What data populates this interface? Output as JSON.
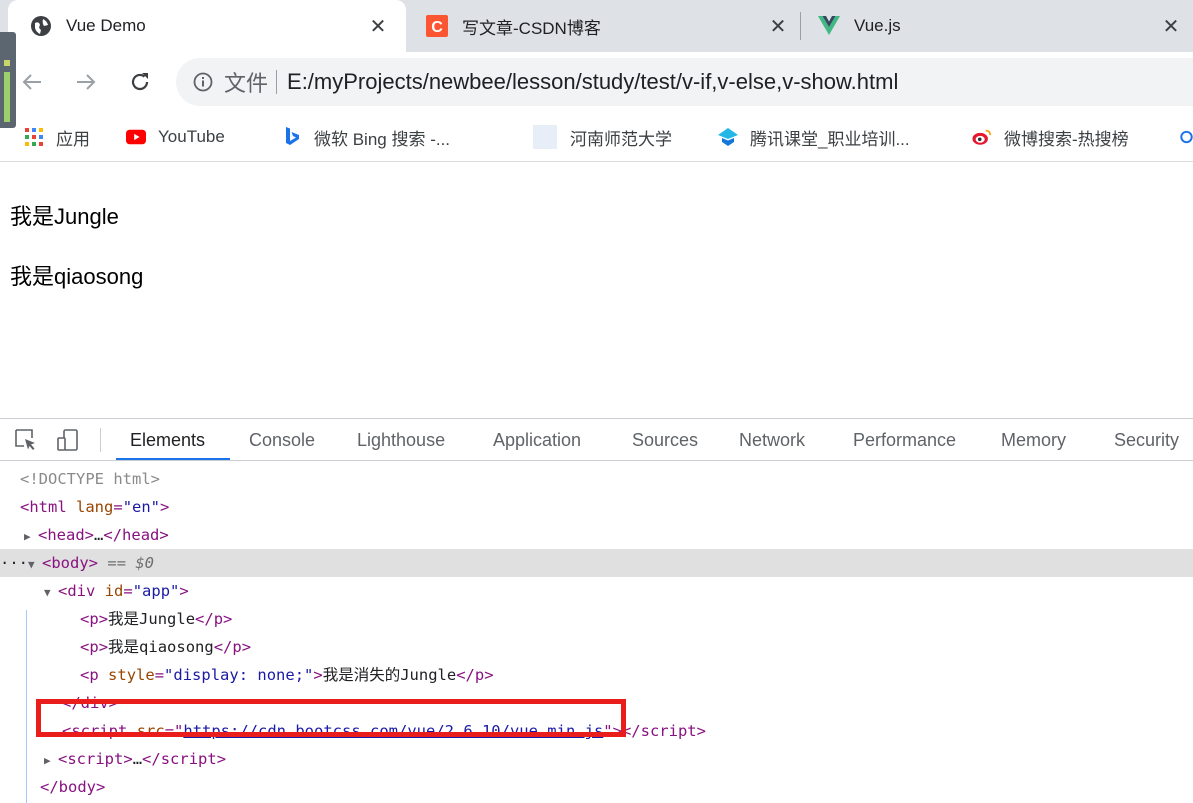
{
  "browser": {
    "tabs": [
      {
        "title": "Vue Demo",
        "icon": "globe-icon",
        "active": true,
        "close": "✕"
      },
      {
        "title": "写文章-CSDN博客",
        "icon": "csdn-icon",
        "active": false,
        "close": "✕"
      },
      {
        "title": "Vue.js",
        "icon": "vue-icon",
        "active": false,
        "close": "✕"
      }
    ],
    "address": {
      "scheme_label": "文件",
      "url": "E:/myProjects/newbee/lesson/study/test/v-if,v-else,v-show.html"
    },
    "bookmarks": [
      {
        "label": "应用",
        "icon": "apps-grid-icon"
      },
      {
        "label": "YouTube",
        "icon": "youtube-icon"
      },
      {
        "label": "微软 Bing 搜索 -...",
        "icon": "bing-icon"
      },
      {
        "label": "河南师范大学",
        "icon": "blank-page-icon"
      },
      {
        "label": "腾讯课堂_职业培训...",
        "icon": "tencent-classroom-icon"
      },
      {
        "label": "微博搜索-热搜榜",
        "icon": "weibo-icon"
      }
    ]
  },
  "page": {
    "paragraphs": [
      "我是Jungle",
      "我是qiaosong"
    ]
  },
  "devtools": {
    "tabs": [
      "Elements",
      "Console",
      "Lighthouse",
      "Application",
      "Sources",
      "Network",
      "Performance",
      "Memory",
      "Security"
    ],
    "active_tab": "Elements",
    "dom": {
      "doctype": "<!DOCTYPE html>",
      "html_tag": "html",
      "html_attr": "lang",
      "html_val": "\"en\"",
      "head_tag": "head",
      "ellipsis": "…",
      "body_tag": "body",
      "body_suffix": "== $0",
      "div_tag": "div",
      "div_attr": "id",
      "div_val": "\"app\"",
      "p1_text": "我是Jungle",
      "p2_text": "我是qiaosong",
      "p3_attr": "style",
      "p3_val": "\"display: none;\"",
      "p3_text": "我是消失的Jungle",
      "script_tag": "script",
      "script_attr": "src",
      "script_src": "https://cdn.bootcss.com/vue/2.6.10/vue.min.js",
      "p_tag": "p"
    }
  },
  "colors": {
    "highlight_box": "#ea1d1d",
    "tag": "#881280",
    "attribute": "#994500",
    "value": "#1a1aa6",
    "active_tab_underline": "#1a73e8"
  }
}
